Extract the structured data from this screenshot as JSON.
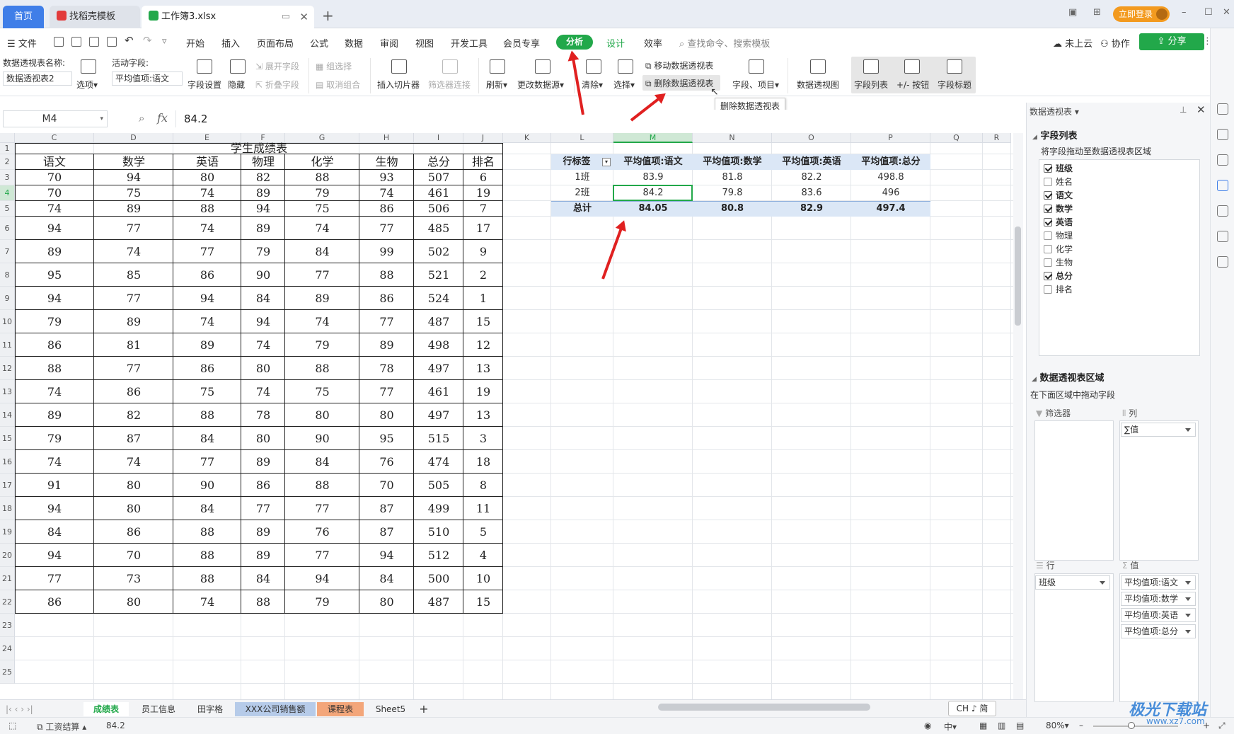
{
  "tabs": {
    "home": "首页",
    "template": "找稻壳模板",
    "workbook": "工作簿3.xlsx"
  },
  "titlebar": {
    "login": "立即登录"
  },
  "menu": {
    "file": "文件",
    "items": [
      "开始",
      "插入",
      "页面布局",
      "公式",
      "数据",
      "审阅",
      "视图",
      "开发工具",
      "会员专享"
    ],
    "analyze": "分析",
    "design": "设计",
    "efficiency": "效率",
    "search": "查找命令、搜索模板",
    "cloud": "未上云",
    "collab": "协作",
    "share": "分享"
  },
  "ribbon": {
    "pivot_name_label": "数据透视表名称:",
    "pivot_name_value": "数据透视表2",
    "options": "选项",
    "active_field_label": "活动字段:",
    "active_field_value": "平均值项:语文",
    "field_settings": "字段设置",
    "hide": "隐藏",
    "expand_field": "展开字段",
    "collapse_field": "折叠字段",
    "group_selection": "组选择",
    "ungroup": "取消组合",
    "insert_slicer": "插入切片器",
    "filter_connection": "筛选器连接",
    "refresh": "刷新",
    "change_source": "更改数据源",
    "clear": "清除",
    "select": "选择",
    "move_pivot": "移动数据透视表",
    "delete_pivot": "删除数据透视表",
    "fields_items": "字段、项目",
    "pivot_chart": "数据透视图",
    "field_list": "字段列表",
    "plus_minus": "+/- 按钮",
    "field_headers": "字段标题",
    "tooltip": "删除数据透视表"
  },
  "formula": {
    "cell_ref": "M4",
    "fx": "fx",
    "value": "84.2"
  },
  "columns": [
    "C",
    "D",
    "E",
    "F",
    "G",
    "H",
    "I",
    "J",
    "K",
    "L",
    "M",
    "N",
    "O",
    "P",
    "Q",
    "R"
  ],
  "rows": [
    "1",
    "2",
    "3",
    "4",
    "5",
    "6",
    "7",
    "8",
    "9",
    "10",
    "11",
    "12",
    "13",
    "14",
    "15",
    "16",
    "17",
    "18",
    "19",
    "20",
    "21",
    "22",
    "23",
    "24",
    "25"
  ],
  "score_table": {
    "title": "学生成绩表",
    "headers": [
      "语文",
      "数学",
      "英语",
      "物理",
      "化学",
      "生物",
      "总分",
      "排名"
    ],
    "rows": [
      [
        "70",
        "94",
        "80",
        "82",
        "88",
        "93",
        "507",
        "6"
      ],
      [
        "70",
        "75",
        "74",
        "89",
        "79",
        "74",
        "461",
        "19"
      ],
      [
        "74",
        "89",
        "88",
        "94",
        "75",
        "86",
        "506",
        "7"
      ],
      [
        "94",
        "77",
        "74",
        "89",
        "74",
        "77",
        "485",
        "17"
      ],
      [
        "89",
        "74",
        "77",
        "79",
        "84",
        "99",
        "502",
        "9"
      ],
      [
        "95",
        "85",
        "86",
        "90",
        "77",
        "88",
        "521",
        "2"
      ],
      [
        "94",
        "77",
        "94",
        "84",
        "89",
        "86",
        "524",
        "1"
      ],
      [
        "79",
        "89",
        "74",
        "94",
        "74",
        "77",
        "487",
        "15"
      ],
      [
        "86",
        "81",
        "89",
        "74",
        "79",
        "89",
        "498",
        "12"
      ],
      [
        "88",
        "77",
        "86",
        "80",
        "88",
        "78",
        "497",
        "13"
      ],
      [
        "74",
        "86",
        "75",
        "74",
        "75",
        "77",
        "461",
        "19"
      ],
      [
        "89",
        "82",
        "88",
        "78",
        "80",
        "80",
        "497",
        "13"
      ],
      [
        "79",
        "87",
        "84",
        "80",
        "90",
        "95",
        "515",
        "3"
      ],
      [
        "74",
        "74",
        "77",
        "89",
        "84",
        "76",
        "474",
        "18"
      ],
      [
        "91",
        "80",
        "90",
        "86",
        "88",
        "70",
        "505",
        "8"
      ],
      [
        "94",
        "80",
        "84",
        "77",
        "77",
        "87",
        "499",
        "11"
      ],
      [
        "84",
        "86",
        "88",
        "89",
        "76",
        "87",
        "510",
        "5"
      ],
      [
        "94",
        "70",
        "88",
        "89",
        "77",
        "94",
        "512",
        "4"
      ],
      [
        "77",
        "73",
        "88",
        "84",
        "94",
        "84",
        "500",
        "10"
      ],
      [
        "86",
        "80",
        "74",
        "88",
        "79",
        "80",
        "487",
        "15"
      ]
    ]
  },
  "pivot": {
    "headers": [
      "行标签",
      "平均值项:语文",
      "平均值项:数学",
      "平均值项:英语",
      "平均值项:总分"
    ],
    "rows": [
      [
        "1班",
        "83.9",
        "81.8",
        "82.2",
        "498.8"
      ],
      [
        "2班",
        "84.2",
        "79.8",
        "83.6",
        "496"
      ]
    ],
    "total": [
      "总计",
      "84.05",
      "80.8",
      "82.9",
      "497.4"
    ]
  },
  "sheet_tabs": [
    "成绩表",
    "员工信息",
    "田字格",
    "XXX公司销售额",
    "课程表",
    "Sheet5"
  ],
  "statusbar": {
    "macro": "工资结算",
    "value": "84.2",
    "ime": "CH ♪ 简",
    "zoom": "80%"
  },
  "panel": {
    "title": "数据透视表",
    "field_list": "字段列表",
    "drag_hint": "将字段拖动至数据透视表区域",
    "fields": [
      {
        "name": "班级",
        "checked": true
      },
      {
        "name": "姓名",
        "checked": false
      },
      {
        "name": "语文",
        "checked": true
      },
      {
        "name": "数学",
        "checked": true
      },
      {
        "name": "英语",
        "checked": true
      },
      {
        "name": "物理",
        "checked": false
      },
      {
        "name": "化学",
        "checked": false
      },
      {
        "name": "生物",
        "checked": false
      },
      {
        "name": "总分",
        "checked": true
      },
      {
        "name": "排名",
        "checked": false
      }
    ],
    "areas_title": "数据透视表区域",
    "areas_hint": "在下面区域中拖动字段",
    "filter": "筛选器",
    "columns": "列",
    "rows": "行",
    "values": "值",
    "column_items": [
      "∑值"
    ],
    "row_items": [
      "班级"
    ],
    "value_items": [
      "平均值项:语文",
      "平均值项:数学",
      "平均值项:英语",
      "平均值项:总分"
    ]
  },
  "watermark": {
    "brand": "极光下载站",
    "url": "www.xz7.com"
  },
  "colors": {
    "accent_green": "#22a84a",
    "tab_blue": "#3f7ee8",
    "pivot_header": "#dbe7f6",
    "arrow_red": "#e02020"
  }
}
